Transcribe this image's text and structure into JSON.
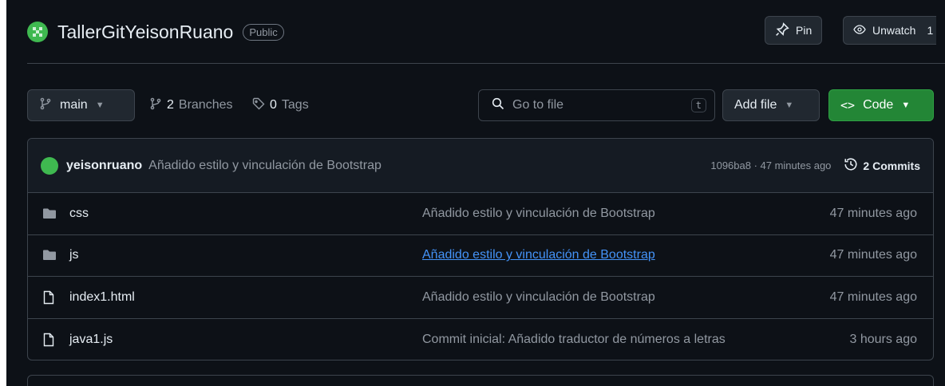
{
  "repo": {
    "name": "TallerGitYeisonRuano",
    "visibility": "Public",
    "pin_label": "Pin",
    "unwatch_label": "Unwatch",
    "unwatch_count": "1"
  },
  "toolbar": {
    "branch": "main",
    "branches_count": "2",
    "branches_label": "Branches",
    "tags_count": "0",
    "tags_label": "Tags",
    "search_placeholder": "Go to file",
    "search_shortcut": "t",
    "add_file_label": "Add file",
    "code_label": "Code"
  },
  "latest_commit": {
    "author": "yeisonruano",
    "message": "Añadido estilo y vinculación de Bootstrap",
    "meta": "1096ba8 · 47 minutes ago",
    "commits_label": "2 Commits"
  },
  "files": [
    {
      "name": "css",
      "type": "folder",
      "message": "Añadido estilo y vinculación de Bootstrap",
      "time": "47 minutes ago",
      "hovered": false
    },
    {
      "name": "js",
      "type": "folder",
      "message": "Añadido estilo y vinculación de Bootstrap",
      "time": "47 minutes ago",
      "hovered": true
    },
    {
      "name": "index1.html",
      "type": "file",
      "message": "Añadido estilo y vinculación de Bootstrap",
      "time": "47 minutes ago",
      "hovered": false
    },
    {
      "name": "java1.js",
      "type": "file",
      "message": "Commit inicial: Añadido traductor de números a letras",
      "time": "3 hours ago",
      "hovered": false
    }
  ],
  "icons": {
    "branch": "git-branch-icon",
    "tag": "tag-icon",
    "search": "search-icon",
    "pin": "pin-icon",
    "eye": "eye-icon",
    "history": "history-icon",
    "folder": "folder-icon",
    "file": "file-icon",
    "code": "code-icon"
  },
  "colors": {
    "background": "#0d1117",
    "border": "#3d444d",
    "green": "#238636",
    "link": "#4493f8",
    "muted": "#9198a1"
  }
}
